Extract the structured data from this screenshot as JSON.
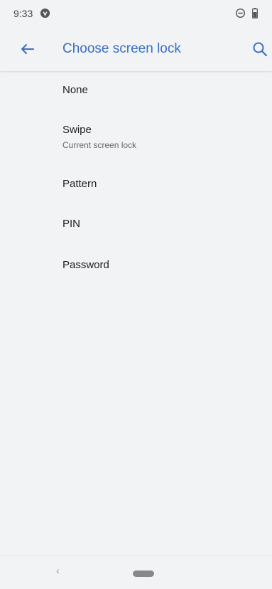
{
  "status_bar": {
    "time": "9:33"
  },
  "app_bar": {
    "title": "Choose screen lock",
    "accent_color": "#3a6fc4"
  },
  "lock_options": [
    {
      "title": "None",
      "summary": ""
    },
    {
      "title": "Swipe",
      "summary": "Current screen lock"
    },
    {
      "title": "Pattern",
      "summary": ""
    },
    {
      "title": "PIN",
      "summary": ""
    },
    {
      "title": "Password",
      "summary": ""
    }
  ],
  "nav_bar": {
    "back_glyph": "‹"
  },
  "icons": [
    "notification-icon",
    "do-not-disturb-icon",
    "battery-icon",
    "back-arrow-icon",
    "search-icon"
  ]
}
